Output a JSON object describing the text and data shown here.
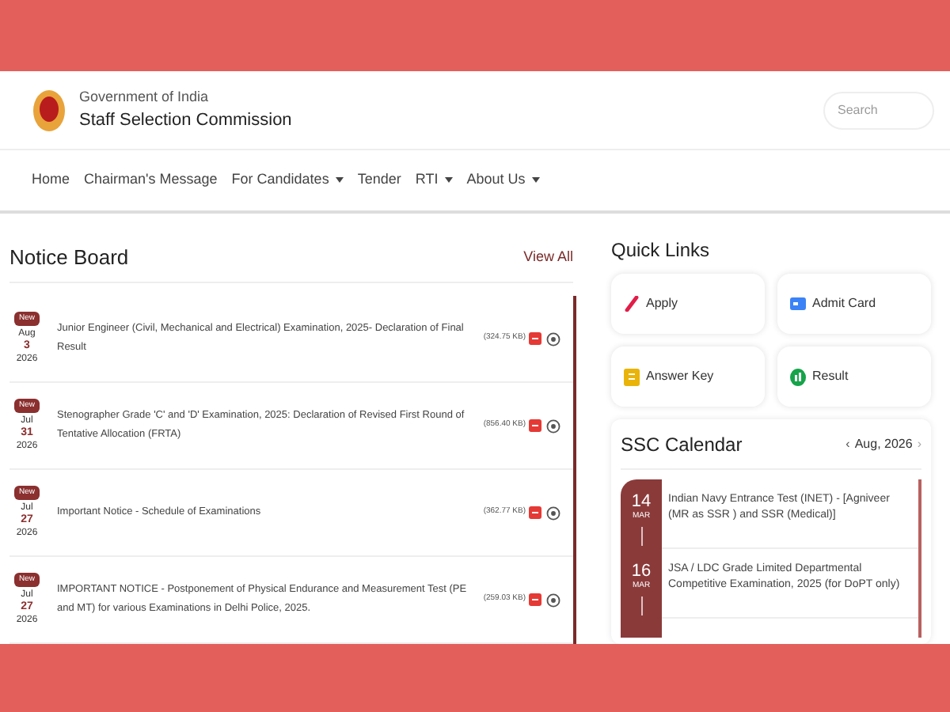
{
  "header": {
    "org_line": "Government of India",
    "title": "Staff Selection Commission",
    "search": {
      "placeholder": "Search"
    }
  },
  "nav": [
    {
      "label": "Home",
      "dropdown": false
    },
    {
      "label": "Chairman's Message",
      "dropdown": false
    },
    {
      "label": "For Candidates",
      "dropdown": true
    },
    {
      "label": "Tender",
      "dropdown": false
    },
    {
      "label": "RTI",
      "dropdown": true
    },
    {
      "label": "About Us",
      "dropdown": true
    }
  ],
  "notice_board": {
    "title": "Notice Board",
    "view_all": "View All",
    "notices": [
      {
        "badge": "New",
        "month": "Aug",
        "day": "3",
        "year": "2026",
        "text": "Junior Engineer (Civil, Mechanical and Electrical) Examination, 2025- Declaration of Final Result",
        "size": "(324.75 KB)"
      },
      {
        "badge": "New",
        "month": "Jul",
        "day": "31",
        "year": "2026",
        "text": "Stenographer Grade 'C' and 'D' Examination, 2025: Declaration of Revised First Round of Tentative Allocation (FRTA)",
        "size": "(856.40 KB)"
      },
      {
        "badge": "New",
        "month": "Jul",
        "day": "27",
        "year": "2026",
        "text": "Important Notice - Schedule of Examinations",
        "size": "(362.77 KB)"
      },
      {
        "badge": "New",
        "month": "Jul",
        "day": "27",
        "year": "2026",
        "text": "IMPORTANT NOTICE - Postponement of Physical Endurance and Measurement Test (PE and MT) for various Examinations in Delhi Police, 2025.",
        "size": "(259.03 KB)"
      }
    ]
  },
  "quick_links": {
    "title": "Quick Links",
    "items": [
      {
        "label": "Apply",
        "kind": "pencil",
        "color": "#e11d48"
      },
      {
        "label": "Admit Card",
        "kind": "card",
        "color": "#3b82f6"
      },
      {
        "label": "Answer Key",
        "kind": "document",
        "color": "#eab308"
      },
      {
        "label": "Result",
        "kind": "chart",
        "color": "#16a34a"
      }
    ]
  },
  "calendar": {
    "title": "SSC Calendar",
    "prev": "‹",
    "month": "Aug, 2026",
    "next": "›",
    "events": [
      {
        "day": "14",
        "month": "MAR",
        "text": "Indian Navy Entrance Test (INET) - [Agniveer (MR as SSR ) and SSR (Medical)]"
      },
      {
        "day": "16",
        "month": "MAR",
        "text": "JSA / LDC Grade Limited Departmental Competitive Examination, 2025 (for DoPT only)"
      }
    ]
  }
}
